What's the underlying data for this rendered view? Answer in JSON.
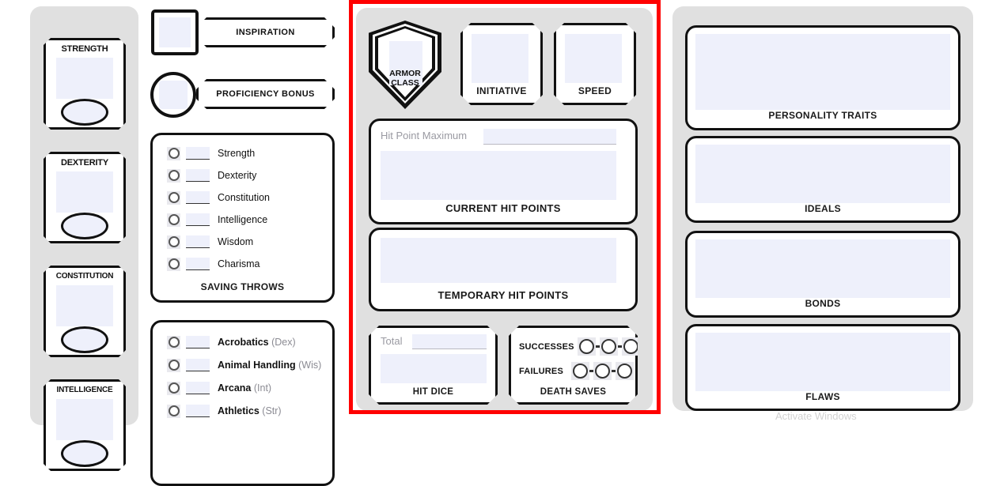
{
  "document": {
    "title": "D&D 5E Character Sheet",
    "colors": {
      "highlight": "#ff0000",
      "panel": "#e0e0e0",
      "field": "#eef0fb",
      "ink": "#111111",
      "muted": "#8b8b93"
    }
  },
  "abilities": {
    "items": [
      {
        "name": "STRENGTH",
        "score": "",
        "modifier": ""
      },
      {
        "name": "DEXTERITY",
        "score": "",
        "modifier": ""
      },
      {
        "name": "CONSTITUTION",
        "score": "",
        "modifier": ""
      },
      {
        "name": "INTELLIGENCE",
        "score": "",
        "modifier": ""
      }
    ]
  },
  "inspiration": {
    "label": "INSPIRATION",
    "value": ""
  },
  "proficiency_bonus": {
    "label": "PROFICIENCY BONUS",
    "value": ""
  },
  "saving_throws": {
    "caption": "SAVING THROWS",
    "items": [
      {
        "label": "Strength",
        "value": "",
        "proficient": false
      },
      {
        "label": "Dexterity",
        "value": "",
        "proficient": false
      },
      {
        "label": "Constitution",
        "value": "",
        "proficient": false
      },
      {
        "label": "Intelligence",
        "value": "",
        "proficient": false
      },
      {
        "label": "Wisdom",
        "value": "",
        "proficient": false
      },
      {
        "label": "Charisma",
        "value": "",
        "proficient": false
      }
    ]
  },
  "skills": {
    "items": [
      {
        "label": "Acrobatics",
        "abbr": "(Dex)",
        "value": "",
        "proficient": false
      },
      {
        "label": "Animal Handling",
        "abbr": "(Wis)",
        "value": "",
        "proficient": false
      },
      {
        "label": "Arcana",
        "abbr": "(Int)",
        "value": "",
        "proficient": false
      },
      {
        "label": "Athletics",
        "abbr": "(Str)",
        "value": "",
        "proficient": false
      }
    ]
  },
  "combat": {
    "armor_class": {
      "label_line1": "ARMOR",
      "label_line2": "CLASS",
      "value": ""
    },
    "initiative": {
      "label": "INITIATIVE",
      "value": ""
    },
    "speed": {
      "label": "SPEED",
      "value": ""
    },
    "current_hit_points": {
      "caption": "CURRENT HIT POINTS",
      "sub_label": "Hit Point Maximum",
      "max_value": "",
      "value": ""
    },
    "temporary_hit_points": {
      "caption": "TEMPORARY HIT POINTS",
      "value": ""
    },
    "hit_dice": {
      "caption": "HIT DICE",
      "total_label": "Total",
      "total_value": "",
      "value": ""
    },
    "death_saves": {
      "caption": "DEATH SAVES",
      "successes_label": "SUCCESSES",
      "failures_label": "FAILURES",
      "successes": [
        false,
        false,
        false
      ],
      "failures": [
        false,
        false,
        false
      ]
    }
  },
  "character_description": {
    "items": [
      {
        "caption": "PERSONALITY TRAITS",
        "value": ""
      },
      {
        "caption": "IDEALS",
        "value": ""
      },
      {
        "caption": "BONDS",
        "value": ""
      },
      {
        "caption": "FLAWS",
        "value": ""
      }
    ]
  },
  "watermark": {
    "text": "Activate Windows"
  }
}
